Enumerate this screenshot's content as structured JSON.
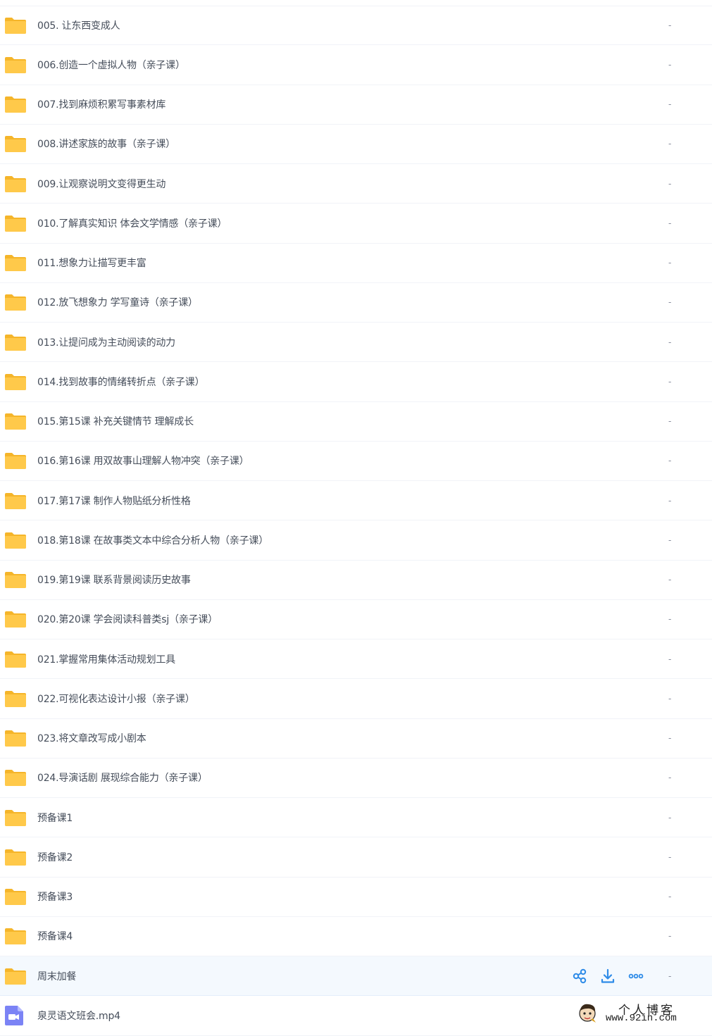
{
  "colors": {
    "folder": "#ffc94a",
    "folder_tab": "#f5b52a",
    "video_icon": "#7b83f5",
    "action_icon": "#2f8ce8",
    "hover_row": "#f4f9fe"
  },
  "rows": [
    {
      "name": "005. 让东西变成人",
      "size": "-",
      "icon": "folder-icon"
    },
    {
      "name": "006.创造一个虚拟人物（亲子课）",
      "size": "-",
      "icon": "folder-icon"
    },
    {
      "name": "007.找到麻烦积累写事素材库",
      "size": "-",
      "icon": "folder-icon"
    },
    {
      "name": "008.讲述家族的故事（亲子课）",
      "size": "-",
      "icon": "folder-icon"
    },
    {
      "name": "009.让观察说明文变得更生动",
      "size": "-",
      "icon": "folder-icon"
    },
    {
      "name": "010.了解真实知识 体会文学情感（亲子课）",
      "size": "-",
      "icon": "folder-icon"
    },
    {
      "name": "011.想象力让描写更丰富",
      "size": "-",
      "icon": "folder-icon"
    },
    {
      "name": "012.放飞想象力 学写童诗（亲子课）",
      "size": "-",
      "icon": "folder-icon"
    },
    {
      "name": "013.让提问成为主动阅读的动力",
      "size": "-",
      "icon": "folder-icon"
    },
    {
      "name": "014.找到故事的情绪转折点（亲子课）",
      "size": "-",
      "icon": "folder-icon"
    },
    {
      "name": "015.第15课 补充关键情节 理解成长",
      "size": "-",
      "icon": "folder-icon"
    },
    {
      "name": "016.第16课 用双故事山理解人物冲突（亲子课）",
      "size": "-",
      "icon": "folder-icon"
    },
    {
      "name": "017.第17课 制作人物贴纸分析性格",
      "size": "-",
      "icon": "folder-icon"
    },
    {
      "name": "018.第18课 在故事类文本中综合分析人物（亲子课）",
      "size": "-",
      "icon": "folder-icon"
    },
    {
      "name": "019.第19课 联系背景阅读历史故事",
      "size": "-",
      "icon": "folder-icon"
    },
    {
      "name": "020.第20课 学会阅读科普类sj（亲子课）",
      "size": "-",
      "icon": "folder-icon"
    },
    {
      "name": "021.掌握常用集体活动规划工具",
      "size": "-",
      "icon": "folder-icon"
    },
    {
      "name": "022.可视化表达设计小报（亲子课）",
      "size": "-",
      "icon": "folder-icon"
    },
    {
      "name": "023.将文章改写成小剧本",
      "size": "-",
      "icon": "folder-icon"
    },
    {
      "name": "024.导演话剧 展现综合能力（亲子课）",
      "size": "-",
      "icon": "folder-icon"
    },
    {
      "name": "预备课1",
      "size": "-",
      "icon": "folder-icon"
    },
    {
      "name": "预备课2",
      "size": "-",
      "icon": "folder-icon"
    },
    {
      "name": "预备课3",
      "size": "-",
      "icon": "folder-icon"
    },
    {
      "name": "预备课4",
      "size": "-",
      "icon": "folder-icon"
    },
    {
      "name": "周末加餐",
      "size": "-",
      "icon": "folder-icon",
      "hover": true
    },
    {
      "name": "泉灵语文班会.mp4",
      "size": "",
      "icon": "video-file-icon"
    }
  ],
  "hover_actions": [
    {
      "icon": "share-icon"
    },
    {
      "icon": "download-icon"
    },
    {
      "icon": "more-icon"
    }
  ],
  "watermark": {
    "line1": "个人博客",
    "line2": "www.92in.com"
  }
}
